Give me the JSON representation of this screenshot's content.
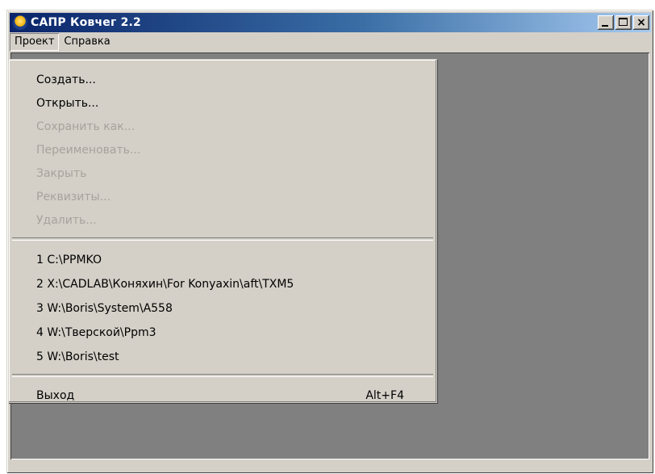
{
  "window": {
    "title": "САПР Ковчег 2.2"
  },
  "menubar": {
    "items": [
      "Проект",
      "Справка"
    ]
  },
  "menu": {
    "items": [
      {
        "label": "Создать...",
        "enabled": true
      },
      {
        "label": "Открыть...",
        "enabled": true
      },
      {
        "label": "Сохранить как...",
        "enabled": false
      },
      {
        "label": "Переименовать...",
        "enabled": false
      },
      {
        "label": "Закрыть",
        "enabled": false
      },
      {
        "label": "Реквизиты...",
        "enabled": false
      },
      {
        "label": "Удалить...",
        "enabled": false
      }
    ],
    "recent": [
      "1 C:\\PPMKO",
      "2 X:\\CADLAB\\Коняхин\\For Konyaxin\\aft\\TXM5",
      "3 W:\\Boris\\System\\A558",
      "4 W:\\Тверской\\Ppm3",
      "5 W:\\Boris\\test"
    ],
    "exit": {
      "label": "Выход",
      "shortcut": "Alt+F4"
    }
  },
  "icons": {
    "app": "app-emblem-icon",
    "minimize": "minimize-icon",
    "maximize": "maximize-icon",
    "close": "close-icon"
  },
  "colors": {
    "title_gradient_start": "#0a246a",
    "title_gradient_end": "#a6caf0",
    "face": "#d4d0c8",
    "client": "#808080",
    "disabled_text": "#a7a39c"
  }
}
